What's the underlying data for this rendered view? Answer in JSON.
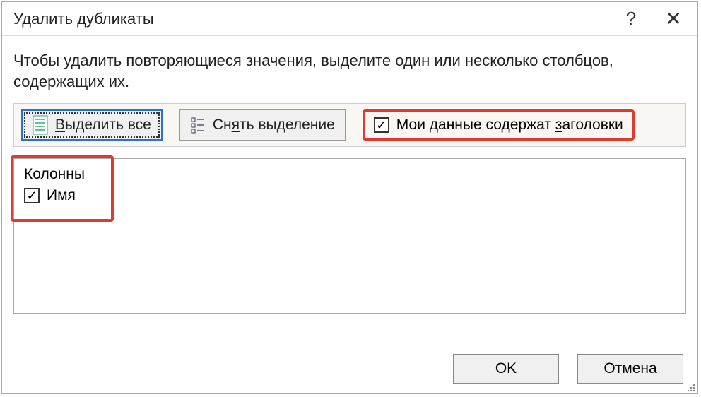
{
  "titlebar": {
    "title": "Удалить дубликаты",
    "help": "?",
    "close": "✕"
  },
  "instruction": "Чтобы удалить повторяющиеся значения, выделите один или несколько столбцов, содержащих их.",
  "toolbar": {
    "select_all_prefix": "В",
    "select_all_rest": "ыделить все",
    "unselect_prefix": "Сн",
    "unselect_u": "я",
    "unselect_rest": "ть выделение",
    "headers_prefix": "Мои данные содержат ",
    "headers_u": "з",
    "headers_rest": "аголовки"
  },
  "columns": {
    "header": "Колонны",
    "items": [
      {
        "label": "Имя",
        "checked": true
      }
    ]
  },
  "footer": {
    "ok": "OK",
    "cancel": "Отмена"
  }
}
